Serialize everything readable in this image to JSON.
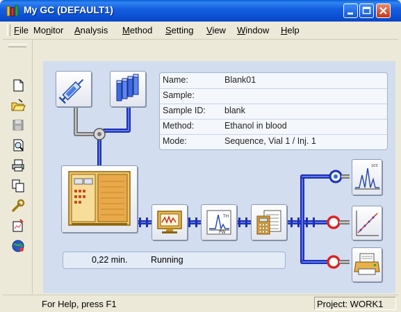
{
  "window": {
    "title": "My GC (DEFAULT1)"
  },
  "menu": [
    {
      "label": "File",
      "mnemonic": "F"
    },
    {
      "label": "Monitor",
      "mnemonic": "n"
    },
    {
      "label": "Analysis",
      "mnemonic": "A"
    },
    {
      "label": "Method",
      "mnemonic": "M"
    },
    {
      "label": "Setting",
      "mnemonic": "S"
    },
    {
      "label": "View",
      "mnemonic": "V"
    },
    {
      "label": "Window",
      "mnemonic": "W"
    },
    {
      "label": "Help",
      "mnemonic": "H"
    }
  ],
  "toolbar": [
    "new-document-icon",
    "open-folder-icon",
    "save-disk-icon",
    "print-preview-icon",
    "print-icon",
    "copy-icon",
    "wrench-icon",
    "report-icon",
    "globe-icon"
  ],
  "info": {
    "rows": [
      {
        "label": "Name:",
        "value": "Blank01"
      },
      {
        "label": "Sample:",
        "value": ""
      },
      {
        "label": "Sample ID:",
        "value": "blank"
      },
      {
        "label": "Method:",
        "value": "Ethanol in blood"
      },
      {
        "label": "Mode:",
        "value": "Sequence, Vial 1 / Inj. 1"
      }
    ]
  },
  "status_panel": {
    "time": "0,22 min.",
    "state": "Running"
  },
  "statusbar": {
    "help": "For Help, press F1",
    "project": "Project: WORK1"
  },
  "colors": {
    "pipe": "#1c2fb5",
    "canvas": "#d2ddef",
    "titlebar": "#0b4fd2"
  }
}
